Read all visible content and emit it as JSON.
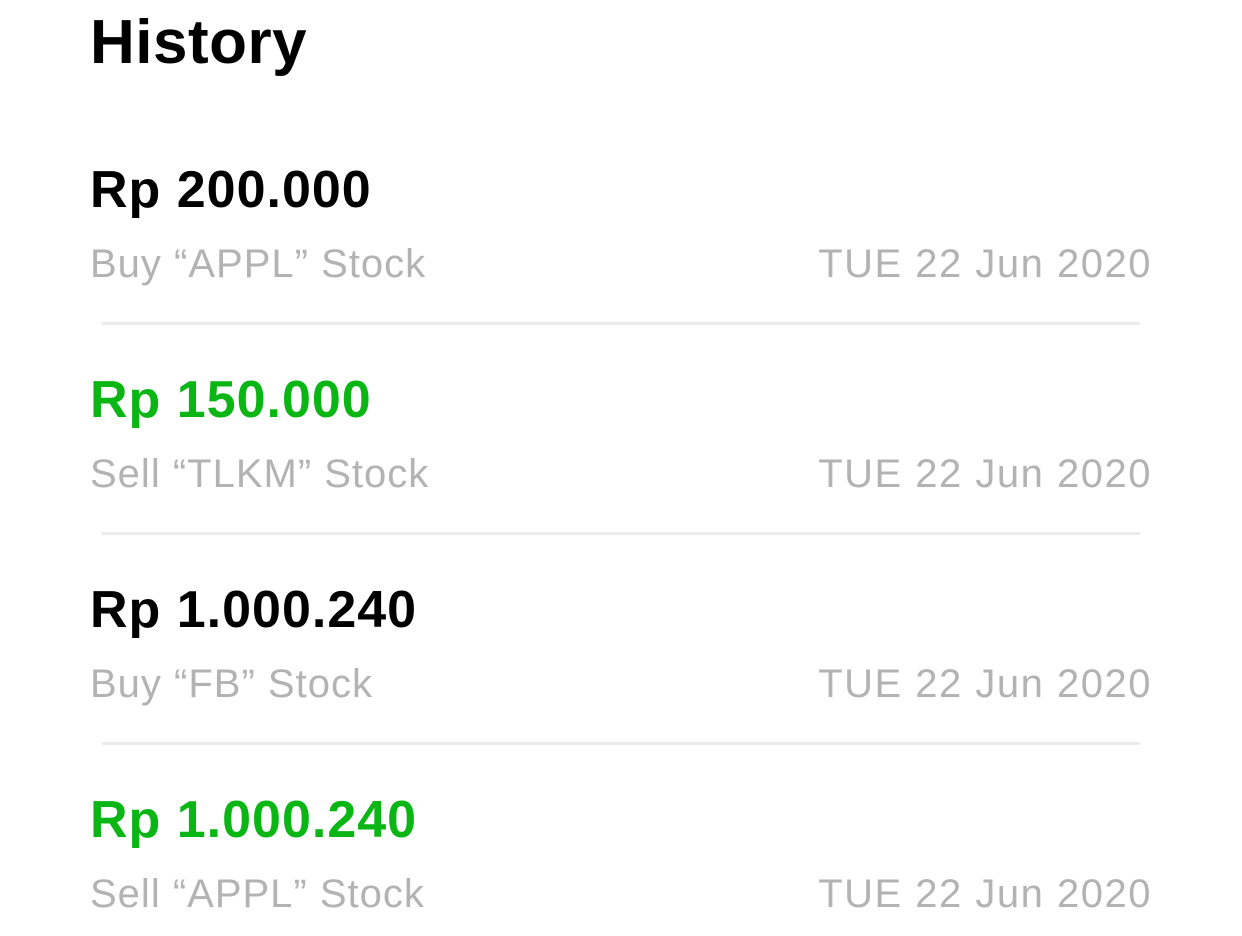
{
  "header": {
    "title": "History"
  },
  "colors": {
    "buy_amount": "#000000",
    "sell_amount": "#0ab614",
    "secondary_text": "#b3b3b3",
    "divider": "#ebebeb",
    "background": "#ffffff"
  },
  "history": {
    "items": [
      {
        "type": "buy",
        "amount": "Rp 200.000",
        "description": "Buy “APPL” Stock",
        "date": "TUE 22 Jun 2020"
      },
      {
        "type": "sell",
        "amount": "Rp 150.000",
        "description": "Sell “TLKM” Stock",
        "date": "TUE 22 Jun 2020"
      },
      {
        "type": "buy",
        "amount": "Rp 1.000.240",
        "description": "Buy “FB” Stock",
        "date": "TUE 22 Jun 2020"
      },
      {
        "type": "sell",
        "amount": "Rp 1.000.240",
        "description": "Sell “APPL” Stock",
        "date": "TUE 22 Jun 2020"
      }
    ]
  }
}
